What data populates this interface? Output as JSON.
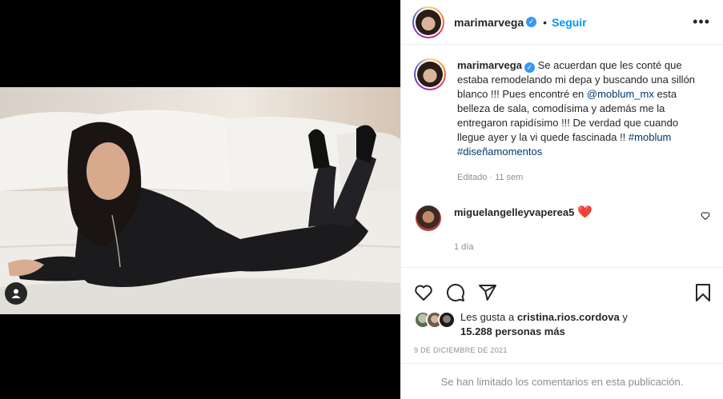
{
  "post": {
    "username": "marimarvega",
    "dot": "•",
    "follow_label": "Seguir",
    "more_label": "•••",
    "caption": {
      "username": "marimarvega",
      "text_1": "Se acuerdan que les conté que estaba remodelando mi depa y buscando una sillón blanco !!! Pues encontré en ",
      "mention": "@moblum_mx",
      "text_2": " esta belleza de sala, comodísima y además me la entregaron rapidísimo !!! De verdad que cuando llegue ayer y la vi quede fascinada !! ",
      "hashtag_1": "#moblum",
      "hashtag_2": "#diseñamomentos",
      "meta": "Editado · 11 sem"
    },
    "comment": {
      "username": "miguelangelleyvaperea5",
      "emoji": "❤️",
      "time": "1 día"
    },
    "likes": {
      "prefix": "Les gusta a ",
      "user": "cristina.rios.cordova",
      "conj": " y",
      "others": "15.288 personas más"
    },
    "date": "9 DE DICIEMBRE DE 2021",
    "comments_limited": "Se han limitado los comentarios en esta publicación."
  },
  "colors": {
    "accent": "#0095f6",
    "link": "#00376b",
    "muted": "#8e8e8e",
    "heart": "#ed4956"
  },
  "icons": [
    "user-tag-icon",
    "verified-badge-icon",
    "more-options-icon",
    "like-icon",
    "comment-icon",
    "share-icon",
    "bookmark-icon",
    "comment-like-icon"
  ]
}
